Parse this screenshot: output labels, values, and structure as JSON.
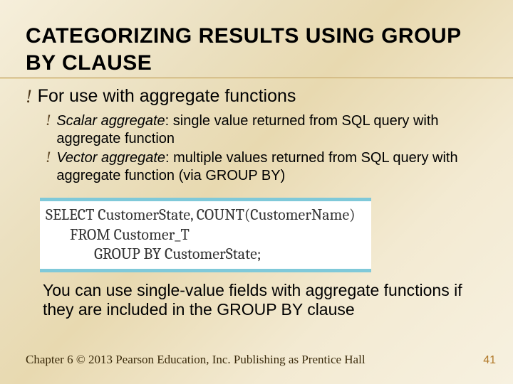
{
  "title": "CATEGORIZING RESULTS USING GROUP BY CLAUSE",
  "bullet1": "For use with aggregate functions",
  "sub": [
    {
      "term": "Scalar aggregate",
      "def": ": single value returned from SQL query with aggregate function"
    },
    {
      "term": "Vector aggregate",
      "def": ": multiple values returned from SQL query with aggregate function (via GROUP BY)"
    }
  ],
  "code": {
    "l1": "SELECT CustomerState, COUNT(CustomerName)",
    "l2": "FROM Customer_T",
    "l3": "GROUP BY CustomerState;"
  },
  "note": "You can use single-value fields with aggregate functions if they are included in the GROUP BY clause",
  "footer": "Chapter 6   © 2013 Pearson Education, Inc.  Publishing as Prentice Hall",
  "page": "41"
}
